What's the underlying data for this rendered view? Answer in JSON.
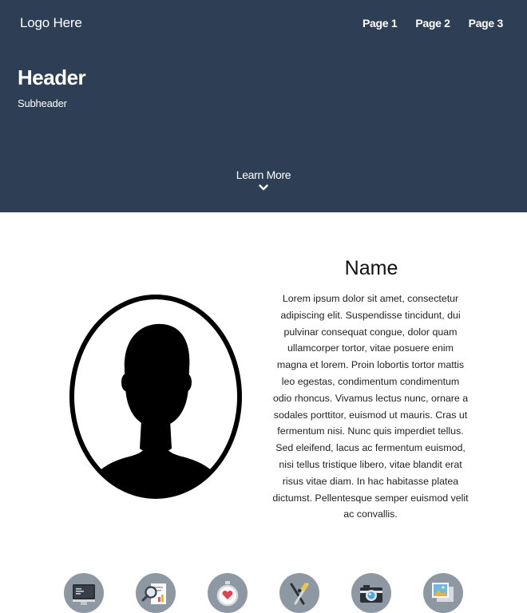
{
  "nav": {
    "logo": "Logo Here",
    "links": [
      "Page 1",
      "Page 2",
      "Page 3"
    ]
  },
  "hero": {
    "title": "Header",
    "subtitle": "Subheader",
    "cta": "Learn More",
    "background_color": "#2e3f55"
  },
  "profile": {
    "name": "Name",
    "bio": "Lorem ipsum dolor sit amet, consectetur adipiscing elit. Suspendisse tincidunt, dui pulvinar consequat congue, dolor quam ullamcorper tortor, vitae posuere enim magna et lorem. Proin lobortis tortor mattis leo egestas, condimentum condimentum odio rhoncus. Vivamus lectus nunc, ornare a sodales porttitor, euismod ut mauris. Cras ut fermentum nisi. Nunc quis imperdiet tellus. Sed eleifend, lacus ac fermentum euismod, nisi tellus tristique libero, vitae blandit erat risus vitae diam. In hac habitasse platea dictumst. Pellentesque semper euismod velit ac convallis.",
    "avatar_icon": "person-silhouette-icon"
  },
  "services": {
    "icons": [
      "computer-icon",
      "report-magnifier-icon",
      "stopwatch-heart-icon",
      "design-tools-icon",
      "camera-icon",
      "picture-gallery-icon"
    ],
    "circle_color": "#8e98a3"
  }
}
